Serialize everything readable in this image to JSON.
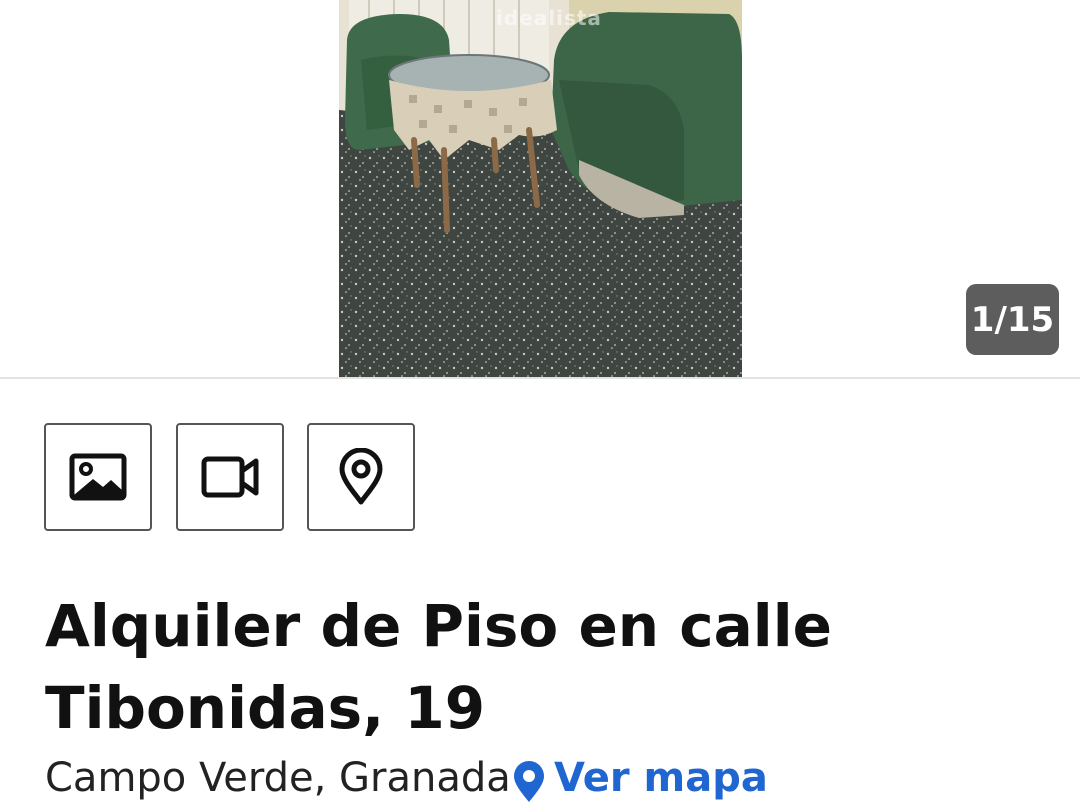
{
  "gallery": {
    "counter": "1/15",
    "watermark": "idealista"
  },
  "media_buttons": [
    {
      "icon": "image-icon"
    },
    {
      "icon": "video-camera-icon"
    },
    {
      "icon": "map-pin-icon"
    }
  ],
  "listing": {
    "title": "Alquiler de Piso en calle Tibonidas, 19",
    "location": "Campo Verde, Granada",
    "map_link": "Ver mapa"
  },
  "colors": {
    "link": "#1f66d1",
    "counter_bg": "#555555",
    "text": "#111111"
  }
}
